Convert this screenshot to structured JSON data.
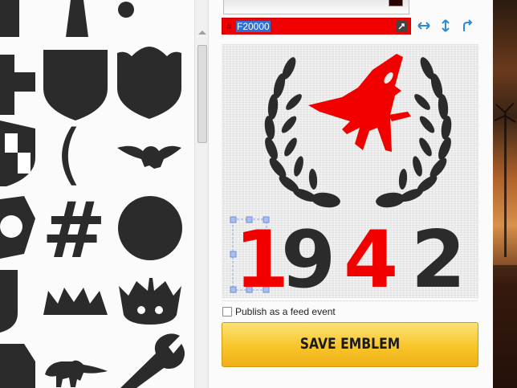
{
  "palette": {
    "shapes": [
      "cross-icon",
      "shield-icon",
      "badge-shield-icon",
      "checkered-shield-icon",
      "paren-glyph",
      "eagle-icon",
      "hexagon-icon",
      "hash-glyph",
      "circle-icon",
      "crown-icon",
      "crown-ornate-icon",
      "trex-icon",
      "wrench-icon"
    ],
    "paren_char": "(",
    "hash_char": "#"
  },
  "color": {
    "hash": "#",
    "hex_value": "F20000",
    "accent": "#f20000",
    "dark": "#2b2b2b"
  },
  "toolbar": {
    "icons": [
      "flip-horizontal-icon",
      "flip-vertical-icon",
      "redo-icon"
    ]
  },
  "emblem": {
    "year_digits": [
      "1",
      "9",
      "4",
      "2"
    ],
    "digit_colors": [
      "#f20000",
      "#2b2b2b",
      "#f20000",
      "#2b2b2b"
    ]
  },
  "feed": {
    "checked": false,
    "label": "Publish as a feed event"
  },
  "save": {
    "label": "SAVE EMBLEM"
  }
}
